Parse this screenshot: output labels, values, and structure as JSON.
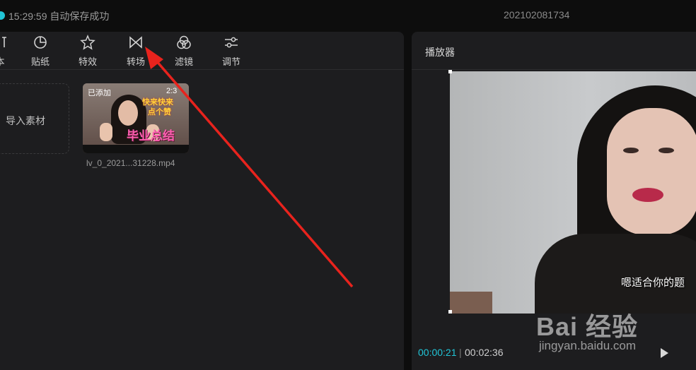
{
  "topbar": {
    "save_status": "15:29:59 自动保存成功",
    "project_title": "202102081734"
  },
  "toolbar": {
    "items": [
      {
        "label": "本",
        "icon": "partial-icon"
      },
      {
        "label": "贴纸",
        "icon": "sticker-icon"
      },
      {
        "label": "特效",
        "icon": "effects-star-icon"
      },
      {
        "label": "转场",
        "icon": "transition-icon"
      },
      {
        "label": "滤镜",
        "icon": "filter-icon"
      },
      {
        "label": "调节",
        "icon": "adjust-sliders-icon"
      }
    ]
  },
  "media": {
    "import_label": "导入素材",
    "clip": {
      "badge": "已添加",
      "duration": "2:3",
      "overlay_line1": "快来快来",
      "overlay_line2": "点个赞",
      "overlay_main": "毕业总结",
      "file_name": "lv_0_2021...31228.mp4"
    }
  },
  "player": {
    "title": "播放器",
    "subtitle": "嗯适合你的题",
    "time_current": "00:00:21",
    "time_total": "00:02:36"
  },
  "watermark": {
    "logo": "Bai 经验",
    "url": "jingyan.baidu.com"
  },
  "colors": {
    "accent": "#21c4d6",
    "arrow": "#e8231d"
  }
}
